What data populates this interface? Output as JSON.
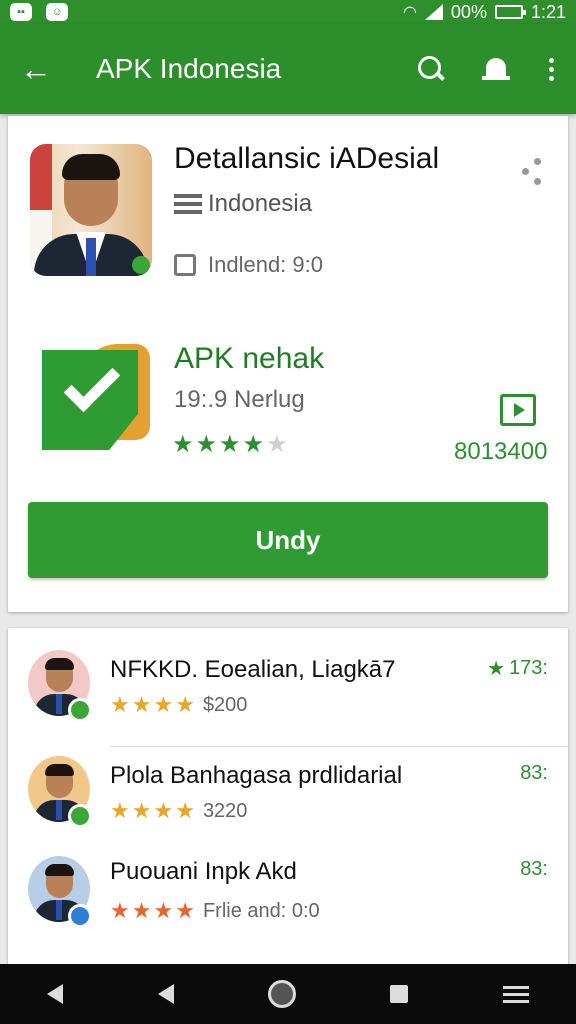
{
  "status_bar": {
    "battery": "00%",
    "time": "1:21"
  },
  "app_bar": {
    "title": "APK Indonesia"
  },
  "featured": {
    "title": "Detallansic iADesial",
    "subtitle": "Indonesia",
    "meta": "Indlend: 9:0"
  },
  "apk": {
    "name": "APK nehak",
    "size": "19:.9 Nerlug",
    "rating_stars": 4,
    "count": "8013400",
    "install_label": "Undy"
  },
  "list": [
    {
      "name": "NFKKD. Eoealian, Liagkā7",
      "rating_stars": 4,
      "star_color": "#e8a62c",
      "count": "$200",
      "side": "173:",
      "side_icon": "star-icon",
      "badge_color": "#3aa635",
      "avatar_bg": "#f2c9c7"
    },
    {
      "name": "Plola Banhagasa prdlidarial",
      "rating_stars": 4,
      "star_color": "#e8a62c",
      "count": "3220",
      "side": "83:",
      "side_icon": "",
      "badge_color": "#3aa635",
      "avatar_bg": "#f2c88a"
    },
    {
      "name": "Puouani Inpk Akd",
      "rating_stars": 4,
      "star_color": "#e3682f",
      "count": "Frlie and: 0:0",
      "side": "83:",
      "side_icon": "",
      "badge_color": "#2f7fd6",
      "avatar_bg": "#b8cde6"
    }
  ],
  "colors": {
    "primary": "#2c8f2b",
    "button": "#2f9b32",
    "accent_text": "#1e7d23"
  }
}
